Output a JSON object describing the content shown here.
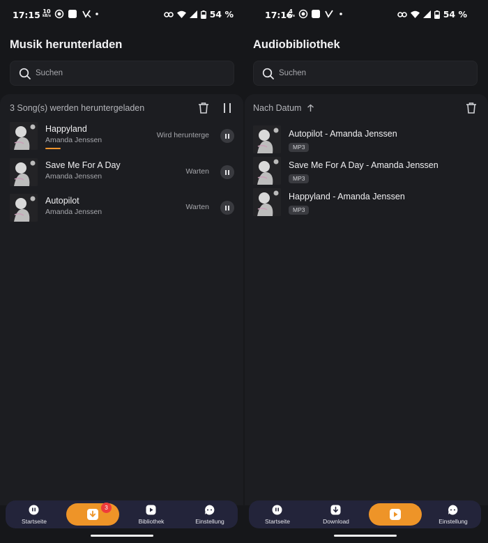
{
  "colors": {
    "accent": "#ee9428",
    "badge": "#ef3b3b",
    "background": "#16171a",
    "panel": "#1c1d21",
    "navbar": "#23243a"
  },
  "left": {
    "status": {
      "time": "17:15",
      "net_value": "10",
      "net_unit": "kB/s",
      "battery": "54 %"
    },
    "title": "Musik herunterladen",
    "search_placeholder": "Suchen",
    "downloads_header": "3 Song(s) werden heruntergeladen",
    "icons": {
      "delete": "trash-icon",
      "pause_all": "pause-icon"
    },
    "songs": [
      {
        "title": "Happyland",
        "artist": "Amanda Jenssen",
        "status": "Wird herunterge",
        "progress": 0.07
      },
      {
        "title": "Save Me For A Day",
        "artist": "Amanda Jenssen",
        "status": "Warten"
      },
      {
        "title": "Autopilot",
        "artist": "Amanda Jenssen",
        "status": "Warten"
      }
    ],
    "nav": {
      "home": "Startseite",
      "download_count": "3",
      "library": "Bibliothek",
      "settings": "Einstellung"
    }
  },
  "right": {
    "status": {
      "time": "17:16",
      "net_value": "4",
      "net_unit": "kB/s",
      "battery": "54 %"
    },
    "title": "Audiobibliothek",
    "search_placeholder": "Suchen",
    "sort_label": "Nach Datum",
    "icons": {
      "sort": "arrow-up-icon",
      "delete": "trash-icon"
    },
    "items": [
      {
        "title": "Autopilot - Amanda Jenssen",
        "format": "MP3"
      },
      {
        "title": "Save Me For A Day - Amanda Jenssen",
        "format": "MP3"
      },
      {
        "title": "Happyland - Amanda Jenssen",
        "format": "MP3"
      }
    ],
    "nav": {
      "home": "Startseite",
      "download": "Download",
      "settings": "Einstellung"
    }
  }
}
